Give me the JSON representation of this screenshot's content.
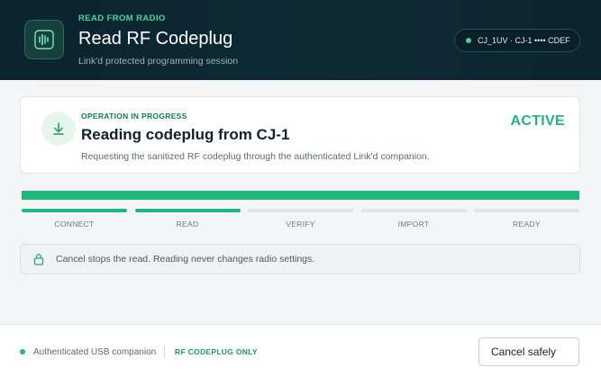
{
  "header": {
    "overline": "READ FROM RADIO",
    "title": "Read RF Codeplug",
    "subtitle": "Link'd protected programming session",
    "app_icon": "waveform-icon",
    "device": {
      "label": "CJ_1UV · CJ-1 •••• CDEF",
      "status_color": "#3ed39a"
    }
  },
  "operation": {
    "icon": "download-icon",
    "overline": "OPERATION IN PROGRESS",
    "title": "Reading codeplug from CJ-1",
    "description": "Requesting the sanitized RF codeplug through the authenticated Link'd companion.",
    "status": "ACTIVE",
    "status_color": "#22b67a"
  },
  "progress": {
    "value": 1.0,
    "fill_color": "#20b87a",
    "steps": [
      {
        "label": "CONNECT",
        "complete": true
      },
      {
        "label": "READ",
        "complete": true
      },
      {
        "label": "VERIFY",
        "complete": false
      },
      {
        "label": "IMPORT",
        "complete": false
      },
      {
        "label": "READY",
        "complete": false
      }
    ]
  },
  "notice": {
    "icon": "lock-icon",
    "text": "Cancel stops the read. Reading never changes radio settings."
  },
  "footer": {
    "connection": "Authenticated USB companion",
    "scope": "RF CODEPLUG ONLY",
    "cancel_label": "Cancel safely"
  },
  "colors": {
    "accent": "#20b87a",
    "header_bg": "#0b2430"
  }
}
